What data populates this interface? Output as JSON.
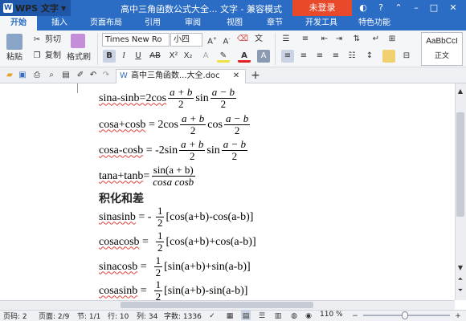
{
  "app": {
    "logo": "WPS 文字",
    "doc_title": "高中三角函数公式大全... 文字 - 兼容模式",
    "login": "未登录"
  },
  "menu_tabs": [
    "开始",
    "插入",
    "页面布局",
    "引用",
    "审阅",
    "视图",
    "章节",
    "开发工具",
    "特色功能"
  ],
  "toolbar": {
    "paste": "粘贴",
    "cut": "剪切",
    "copy": "复制",
    "format_painter": "格式刷",
    "font_name": "Times New Ro",
    "font_size": "小四",
    "style_preview": "AaBbCcI",
    "style_name": "正文"
  },
  "doc_tab": "高中三角函数...大全.doc",
  "formulas": {
    "f1": {
      "left": "sina-sinb=2cos",
      "n1": "a + b",
      "d1": "2",
      "mid": "sin",
      "n2": "a − b",
      "d2": "2"
    },
    "f2": {
      "left": "cosa+cosb",
      "eq": " = 2cos",
      "n1": "a + b",
      "d1": "2",
      "mid": "cos",
      "n2": "a − b",
      "d2": "2"
    },
    "f3": {
      "left": "cosa-cosb",
      "eq": " = -2sin",
      "n1": "a + b",
      "d1": "2",
      "mid": "sin",
      "n2": "a − b",
      "d2": "2"
    },
    "f4": {
      "left": "tana+tanb",
      "eq": "=",
      "num": "sin(a + b)",
      "den": "cosa cosb"
    },
    "heading": "积化和差",
    "f5": {
      "left": "sinasinb",
      "eq": " = - ",
      "n": "1",
      "d": "2",
      "right": "[cos(a+b)-cos(a-b)]"
    },
    "f6": {
      "left": "cosacosb",
      "eq": " =  ",
      "n": "1",
      "d": "2",
      "right": "[cos(a+b)+cos(a-b)]"
    },
    "f7": {
      "left": "sinacosb",
      "eq": " =  ",
      "n": "1",
      "d": "2",
      "right": "[sin(a+b)+sin(a-b)]"
    },
    "f8": {
      "left": "cosasinb",
      "eq": " =  ",
      "n": "1",
      "d": "2",
      "right": "[sin(a+b)-sin(a-b)]"
    }
  },
  "status": {
    "page_num": "页码: 2",
    "page": "页面: 2/9",
    "section": "节: 1/1",
    "row": "行: 10",
    "col": "列: 34",
    "words": "字数: 1336",
    "zoom": "110 %"
  }
}
